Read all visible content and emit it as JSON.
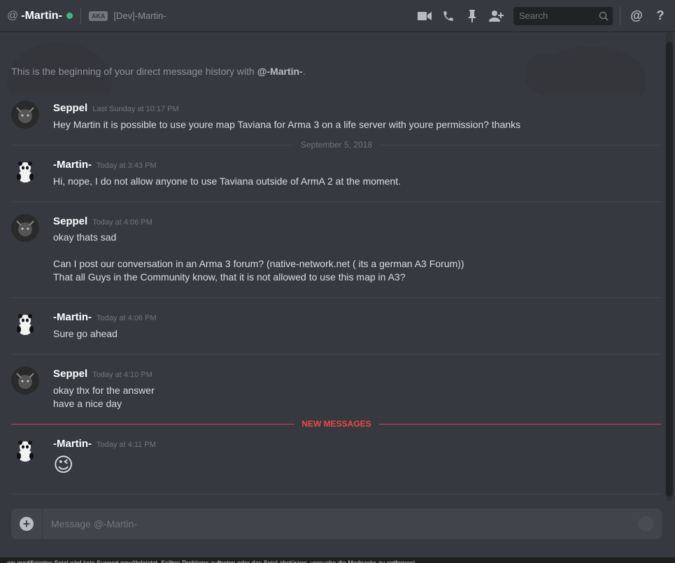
{
  "header": {
    "at_symbol": "@",
    "username": "-Martin-",
    "aka_label": "AKA",
    "nickname": "[Dev]-Martin-",
    "search_placeholder": "Search",
    "mention_symbol": "@",
    "help_symbol": "?",
    "status_color": "#43b581"
  },
  "intro": {
    "text": "This is the beginning of your direct message history with ",
    "target": "@-Martin-",
    "end": "."
  },
  "messages": [
    {
      "user": "Seppel",
      "time": "Last Sunday at 10:17 PM",
      "lines": [
        "Hey Martin it is possible to use youre map Taviana for Arma 3 on a life server with youre permission? thanks"
      ]
    },
    {
      "user": "-Martin-",
      "time": "Today at 3:43 PM",
      "lines": [
        "Hi, nope, I do not allow anyone to use Taviana outside of ArmA 2 at the moment."
      ]
    },
    {
      "user": "Seppel",
      "time": "Today at 4:06 PM",
      "lines": [
        "okay thats sad",
        "Can I post our conversation in an Arma 3 forum? (native-network.net ( its a german A3 Forum))",
        "That all Guys in the Community know, that it is not allowed to use this map in A3?"
      ]
    },
    {
      "user": "-Martin-",
      "time": "Today at 4:06 PM",
      "lines": [
        "Sure go ahead"
      ]
    },
    {
      "user": "Seppel",
      "time": "Today at 4:10 PM",
      "lines": [
        "okay thx for the answer",
        "have a nice day"
      ]
    },
    {
      "user": "-Martin-",
      "time": "Today at 4:11 PM",
      "emoji": "😉"
    }
  ],
  "dividers": {
    "date": "September 5, 2018",
    "new_messages": "NEW MESSAGES"
  },
  "composer": {
    "placeholder": "Message @-Martin-",
    "upload_symbol": "+"
  },
  "bottom_strip": {
    "text": "... ein modifiziertes Spiel wird kein Support gewährleistet. Sollten Probleme auftreten oder das Spiel abstürzen, versuche die Modpacks zu entfernen!"
  }
}
